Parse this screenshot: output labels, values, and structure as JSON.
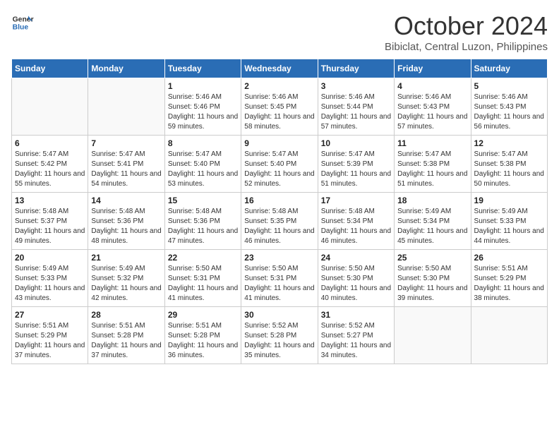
{
  "logo": {
    "line1": "General",
    "line2": "Blue"
  },
  "title": "October 2024",
  "subtitle": "Bibiclat, Central Luzon, Philippines",
  "headers": [
    "Sunday",
    "Monday",
    "Tuesday",
    "Wednesday",
    "Thursday",
    "Friday",
    "Saturday"
  ],
  "weeks": [
    [
      {
        "day": "",
        "sunrise": "",
        "sunset": "",
        "daylight": ""
      },
      {
        "day": "",
        "sunrise": "",
        "sunset": "",
        "daylight": ""
      },
      {
        "day": "1",
        "sunrise": "Sunrise: 5:46 AM",
        "sunset": "Sunset: 5:46 PM",
        "daylight": "Daylight: 11 hours and 59 minutes."
      },
      {
        "day": "2",
        "sunrise": "Sunrise: 5:46 AM",
        "sunset": "Sunset: 5:45 PM",
        "daylight": "Daylight: 11 hours and 58 minutes."
      },
      {
        "day": "3",
        "sunrise": "Sunrise: 5:46 AM",
        "sunset": "Sunset: 5:44 PM",
        "daylight": "Daylight: 11 hours and 57 minutes."
      },
      {
        "day": "4",
        "sunrise": "Sunrise: 5:46 AM",
        "sunset": "Sunset: 5:43 PM",
        "daylight": "Daylight: 11 hours and 57 minutes."
      },
      {
        "day": "5",
        "sunrise": "Sunrise: 5:46 AM",
        "sunset": "Sunset: 5:43 PM",
        "daylight": "Daylight: 11 hours and 56 minutes."
      }
    ],
    [
      {
        "day": "6",
        "sunrise": "Sunrise: 5:47 AM",
        "sunset": "Sunset: 5:42 PM",
        "daylight": "Daylight: 11 hours and 55 minutes."
      },
      {
        "day": "7",
        "sunrise": "Sunrise: 5:47 AM",
        "sunset": "Sunset: 5:41 PM",
        "daylight": "Daylight: 11 hours and 54 minutes."
      },
      {
        "day": "8",
        "sunrise": "Sunrise: 5:47 AM",
        "sunset": "Sunset: 5:40 PM",
        "daylight": "Daylight: 11 hours and 53 minutes."
      },
      {
        "day": "9",
        "sunrise": "Sunrise: 5:47 AM",
        "sunset": "Sunset: 5:40 PM",
        "daylight": "Daylight: 11 hours and 52 minutes."
      },
      {
        "day": "10",
        "sunrise": "Sunrise: 5:47 AM",
        "sunset": "Sunset: 5:39 PM",
        "daylight": "Daylight: 11 hours and 51 minutes."
      },
      {
        "day": "11",
        "sunrise": "Sunrise: 5:47 AM",
        "sunset": "Sunset: 5:38 PM",
        "daylight": "Daylight: 11 hours and 51 minutes."
      },
      {
        "day": "12",
        "sunrise": "Sunrise: 5:47 AM",
        "sunset": "Sunset: 5:38 PM",
        "daylight": "Daylight: 11 hours and 50 minutes."
      }
    ],
    [
      {
        "day": "13",
        "sunrise": "Sunrise: 5:48 AM",
        "sunset": "Sunset: 5:37 PM",
        "daylight": "Daylight: 11 hours and 49 minutes."
      },
      {
        "day": "14",
        "sunrise": "Sunrise: 5:48 AM",
        "sunset": "Sunset: 5:36 PM",
        "daylight": "Daylight: 11 hours and 48 minutes."
      },
      {
        "day": "15",
        "sunrise": "Sunrise: 5:48 AM",
        "sunset": "Sunset: 5:36 PM",
        "daylight": "Daylight: 11 hours and 47 minutes."
      },
      {
        "day": "16",
        "sunrise": "Sunrise: 5:48 AM",
        "sunset": "Sunset: 5:35 PM",
        "daylight": "Daylight: 11 hours and 46 minutes."
      },
      {
        "day": "17",
        "sunrise": "Sunrise: 5:48 AM",
        "sunset": "Sunset: 5:34 PM",
        "daylight": "Daylight: 11 hours and 46 minutes."
      },
      {
        "day": "18",
        "sunrise": "Sunrise: 5:49 AM",
        "sunset": "Sunset: 5:34 PM",
        "daylight": "Daylight: 11 hours and 45 minutes."
      },
      {
        "day": "19",
        "sunrise": "Sunrise: 5:49 AM",
        "sunset": "Sunset: 5:33 PM",
        "daylight": "Daylight: 11 hours and 44 minutes."
      }
    ],
    [
      {
        "day": "20",
        "sunrise": "Sunrise: 5:49 AM",
        "sunset": "Sunset: 5:33 PM",
        "daylight": "Daylight: 11 hours and 43 minutes."
      },
      {
        "day": "21",
        "sunrise": "Sunrise: 5:49 AM",
        "sunset": "Sunset: 5:32 PM",
        "daylight": "Daylight: 11 hours and 42 minutes."
      },
      {
        "day": "22",
        "sunrise": "Sunrise: 5:50 AM",
        "sunset": "Sunset: 5:31 PM",
        "daylight": "Daylight: 11 hours and 41 minutes."
      },
      {
        "day": "23",
        "sunrise": "Sunrise: 5:50 AM",
        "sunset": "Sunset: 5:31 PM",
        "daylight": "Daylight: 11 hours and 41 minutes."
      },
      {
        "day": "24",
        "sunrise": "Sunrise: 5:50 AM",
        "sunset": "Sunset: 5:30 PM",
        "daylight": "Daylight: 11 hours and 40 minutes."
      },
      {
        "day": "25",
        "sunrise": "Sunrise: 5:50 AM",
        "sunset": "Sunset: 5:30 PM",
        "daylight": "Daylight: 11 hours and 39 minutes."
      },
      {
        "day": "26",
        "sunrise": "Sunrise: 5:51 AM",
        "sunset": "Sunset: 5:29 PM",
        "daylight": "Daylight: 11 hours and 38 minutes."
      }
    ],
    [
      {
        "day": "27",
        "sunrise": "Sunrise: 5:51 AM",
        "sunset": "Sunset: 5:29 PM",
        "daylight": "Daylight: 11 hours and 37 minutes."
      },
      {
        "day": "28",
        "sunrise": "Sunrise: 5:51 AM",
        "sunset": "Sunset: 5:28 PM",
        "daylight": "Daylight: 11 hours and 37 minutes."
      },
      {
        "day": "29",
        "sunrise": "Sunrise: 5:51 AM",
        "sunset": "Sunset: 5:28 PM",
        "daylight": "Daylight: 11 hours and 36 minutes."
      },
      {
        "day": "30",
        "sunrise": "Sunrise: 5:52 AM",
        "sunset": "Sunset: 5:28 PM",
        "daylight": "Daylight: 11 hours and 35 minutes."
      },
      {
        "day": "31",
        "sunrise": "Sunrise: 5:52 AM",
        "sunset": "Sunset: 5:27 PM",
        "daylight": "Daylight: 11 hours and 34 minutes."
      },
      {
        "day": "",
        "sunrise": "",
        "sunset": "",
        "daylight": ""
      },
      {
        "day": "",
        "sunrise": "",
        "sunset": "",
        "daylight": ""
      }
    ]
  ]
}
